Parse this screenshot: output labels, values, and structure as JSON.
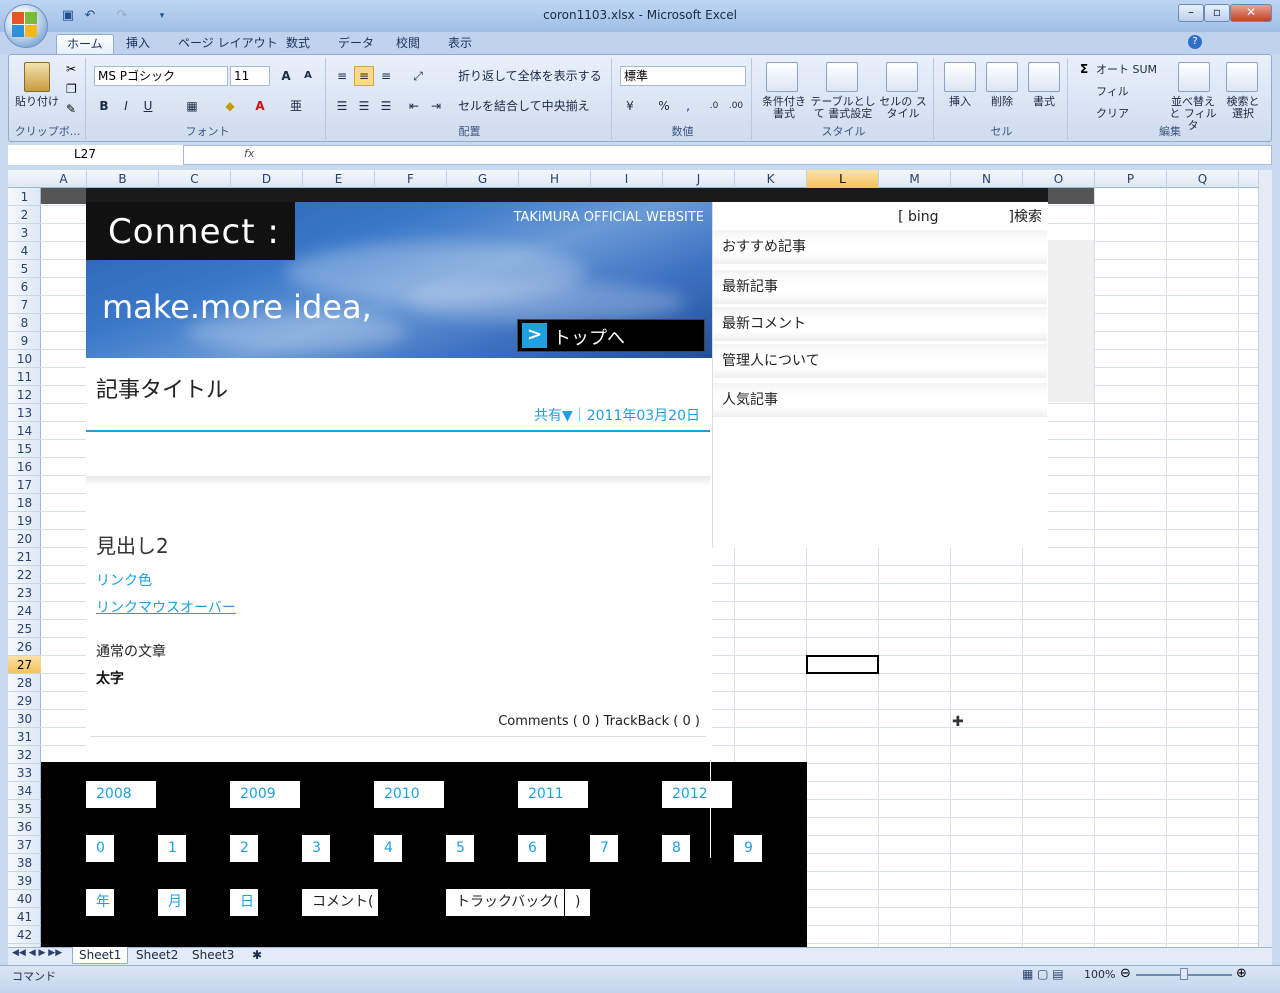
{
  "window": {
    "title": "coron1103.xlsx - Microsoft Excel"
  },
  "ribbon_tabs": [
    "ホーム",
    "挿入",
    "ページ レイアウト",
    "数式",
    "データ",
    "校閲",
    "表示"
  ],
  "clipboard": {
    "paste": "貼り付け",
    "label": "クリップボ..."
  },
  "font": {
    "name": "MS Pゴシック",
    "size": "11",
    "label": "フォント"
  },
  "alignment": {
    "wrap": "折り返して全体を表示する",
    "merge": "セルを結合して中央揃え",
    "label": "配置"
  },
  "number": {
    "format": "標準",
    "label": "数値"
  },
  "styles": {
    "cond": "条件付き 書式",
    "table": "テーブルとして 書式設定",
    "cell": "セルの スタイル",
    "label": "スタイル"
  },
  "cells": {
    "insert": "挿入",
    "delete": "削除",
    "format": "書式",
    "label": "セル"
  },
  "editing": {
    "autosum": "オート SUM",
    "fill": "フィル",
    "clear": "クリア",
    "sort": "並べ替えと フィルタ",
    "find": "検索と 選択",
    "label": "編集"
  },
  "formula_bar": {
    "cell_ref": "L27",
    "fx": "fx"
  },
  "columns": [
    "A",
    "B",
    "C",
    "D",
    "E",
    "F",
    "G",
    "H",
    "I",
    "J",
    "K",
    "L",
    "M",
    "N",
    "O",
    "P",
    "Q"
  ],
  "selected_column": "L",
  "rows": [
    "1",
    "2",
    "3",
    "4",
    "5",
    "6",
    "7",
    "8",
    "9",
    "10",
    "11",
    "12",
    "13",
    "14",
    "15",
    "16",
    "17",
    "18",
    "19",
    "20",
    "21",
    "22",
    "23",
    "24",
    "25",
    "26",
    "27",
    "28",
    "29",
    "30",
    "31",
    "32",
    "33",
    "34",
    "35",
    "36",
    "37",
    "38",
    "39",
    "40",
    "41",
    "42"
  ],
  "selected_row": "27",
  "site": {
    "logo": "Connect :",
    "site_name": "TAKiMURA OFFICIAL WEBSITE",
    "tagline": "make.more idea,",
    "top_button": "トップへ",
    "top_arrow": ">",
    "article_title": "記事タイトル",
    "article_meta": "共有▼｜2011年03月20日",
    "heading2": "見出し2",
    "link_color": "リンク色",
    "link_hover": "リンクマウスオーバー",
    "normal_text": "通常の文章",
    "bold_text": "太字",
    "comments": "Comments ( 0 ) TrackBack ( 0 )",
    "search": "[ bing　　　　　]検索",
    "sidebar": [
      "おすすめ記事",
      "最新記事",
      "最新コメント",
      "管理人について",
      "人気記事"
    ],
    "years": [
      "2008",
      "2009",
      "2010",
      "2011",
      "2012"
    ],
    "digits": [
      "0",
      "1",
      "2",
      "3",
      "4",
      "5",
      "6",
      "7",
      "8",
      "9"
    ],
    "date_units": [
      "年",
      "月",
      "日"
    ],
    "comment_label": "コメント(",
    "trackback_label": "トラックバック(",
    "trackback_close": ")",
    "accent_color": "#1ea0e0"
  },
  "sheets": [
    "Sheet1",
    "Sheet2",
    "Sheet3"
  ],
  "status": {
    "mode": "コマンド",
    "zoom": "100%"
  }
}
